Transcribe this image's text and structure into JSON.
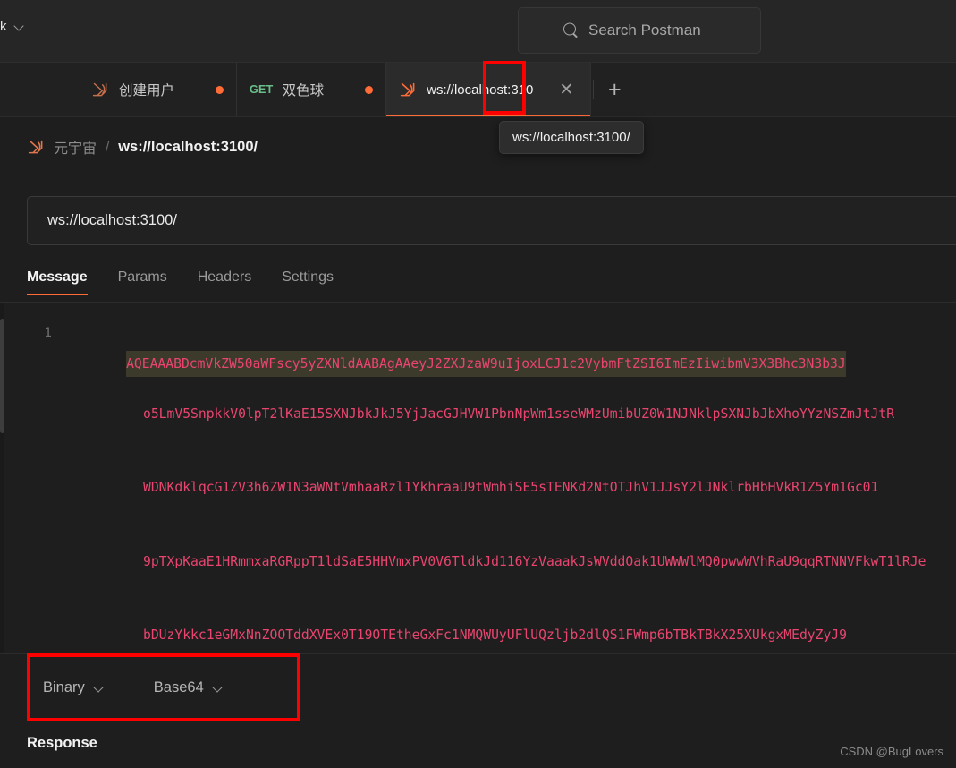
{
  "app": {
    "name": "Postman",
    "theme_bg": "#1e1e1e",
    "accent": "#ff6c37",
    "annotation_color": "#fe0000"
  },
  "header": {
    "workspace_label": "k",
    "workspace_chevron_icon": "chevron-down-icon",
    "search": {
      "placeholder": "Search Postman",
      "value": "",
      "icon": "search-icon"
    }
  },
  "tabs": [
    {
      "label": "创建用户",
      "method": "",
      "icon": "websocket-icon",
      "has_unsaved_dot": true,
      "active": false
    },
    {
      "label": "双色球",
      "method": "GET",
      "icon": "",
      "has_unsaved_dot": true,
      "active": false
    },
    {
      "label": "ws://localhost:310",
      "method": "",
      "icon": "websocket-icon",
      "has_unsaved_dot": false,
      "active": true,
      "close_icon": "close-icon"
    }
  ],
  "new_tab": {
    "label": "+",
    "icon": "plus-icon"
  },
  "tooltip": {
    "text": "ws://localhost:3100/"
  },
  "breadcrumb": {
    "icon": "websocket-icon",
    "collection": "元宇宙",
    "separator": "/",
    "current": "ws://localhost:3100/"
  },
  "url_bar": {
    "value": "ws://localhost:3100/",
    "placeholder": "Enter URL"
  },
  "request_tabs": [
    {
      "label": "Message",
      "active": true
    },
    {
      "label": "Params",
      "active": false
    },
    {
      "label": "Headers",
      "active": false
    },
    {
      "label": "Settings",
      "active": false
    }
  ],
  "editor": {
    "line_number": "1",
    "lines": [
      "AQEAAABDcmVkZW50aWFscy5yZXNldAABAgAAeyJ2ZXJzaW9uIjoxLCJ1c2VybmFtZSI6ImEzIiwibmV3X3Bhc3N3b3J",
      "o5LmV5SnpkkV0lpT2lKaE15SXNJbkJkJ5YjJacGJHVW1PbnNpWm1sseWMzUmibUZ0W1NJNklpSXNJbJbXhoYYzNSZmJtJtR",
      "WDNKdklqcG1ZV3h6ZW1N3aWNtVmhaaRzl1YkhraaU9tWmhiSE5sTENKd2NtOTJhV1JJsY2lJNklrbHbHVkR1Z5Ym1Gc01",
      "9pTXpKaaE1HRmmxaRGRppT1ldSaE5HHVmxPV0V6TldkJd116YzVaaakJsWVddOak1UWWWlMQ0pwwWVhRaU9qqRTNNVFkwT1lRJe",
      "bDUzYkkc1eGMxNnZOOTddXVEx0T19OTEtheGxFc1NMQWUyUFlUQzljb2dlQS1FWmp6bTBkTBkX25XUkgxMEdyZyJ9"
    ],
    "highlight_background": "#3b3a2b",
    "text_color": "#e9456f"
  },
  "message_format": {
    "data_type": {
      "label": "Binary",
      "chevron_icon": "chevron-down-icon",
      "options": [
        "Text",
        "Binary"
      ]
    },
    "encoding": {
      "label": "Base64",
      "chevron_icon": "chevron-down-icon",
      "options": [
        "Base64",
        "Hexadecimal"
      ]
    }
  },
  "response": {
    "title": "Response"
  },
  "watermark": {
    "text": "CSDN @BugLovers"
  }
}
